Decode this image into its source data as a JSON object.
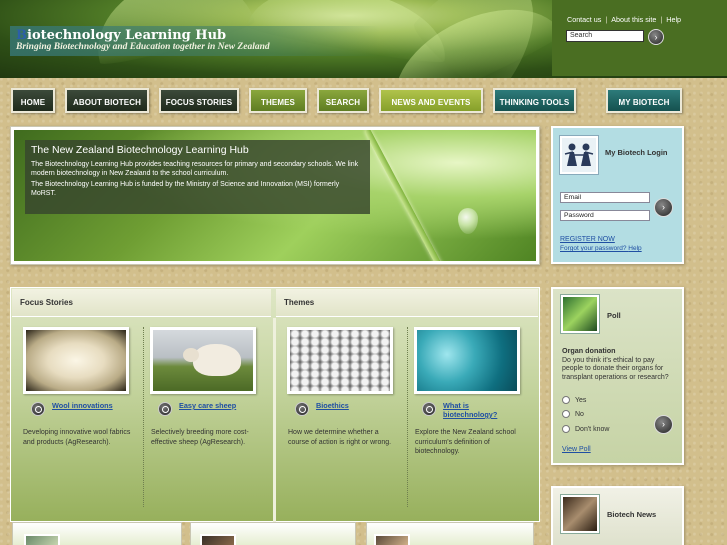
{
  "header": {
    "title_first": "B",
    "title_rest": "iotechnology Learning Hub",
    "tagline": "Bringing Biotechnology and Education together in New Zealand",
    "links": [
      "Contact us",
      "About this site",
      "Help"
    ],
    "search_placeholder": "Search",
    "go_symbol": "›"
  },
  "nav": [
    "HOME",
    "ABOUT BIOTECH",
    "FOCUS STORIES",
    "THEMES",
    "SEARCH",
    "NEWS AND EVENTS",
    "THINKING TOOLS",
    "MY BIOTECH"
  ],
  "hero": {
    "title": "The New Zealand Biotechnology Learning Hub",
    "p1": "The Biotechnology Learning Hub provides teaching resources for primary and secondary schools. We link modern biotechnology in New Zealand to the school curriculum.",
    "p2": "The Biotechnology Learning Hub is funded by the Ministry of Science and Innovation (MSI) formerly MoRST."
  },
  "login": {
    "title": "My Biotech Login",
    "email_placeholder": "Email",
    "password_placeholder": "Password",
    "register": "REGISTER NOW",
    "forgot": "Forgot your password?",
    "help": "Help"
  },
  "focus": {
    "heading": "Focus Stories",
    "cards": [
      {
        "title": "Wool innovations",
        "desc": "Developing innovative wool fabrics and products (AgResearch)."
      },
      {
        "title": "Easy care sheep",
        "desc": "Selectively breeding more cost-effective sheep (AgResearch)."
      }
    ]
  },
  "themes": {
    "heading": "Themes",
    "cards": [
      {
        "title": "Bioethics",
        "desc": "How we determine whether a course of action is right or wrong."
      },
      {
        "title": "What is biotechnology?",
        "desc": "Explore the New Zealand school curriculum's definition of biotechnology."
      }
    ]
  },
  "poll": {
    "title": "Poll",
    "question_title": "Organ donation",
    "question": "Do you think it's ethical to pay people to donate their organs for transplant operations or research?",
    "options": [
      "Yes",
      "No",
      "Don't know"
    ],
    "view": "View Poll"
  },
  "news": {
    "title": "Biotech News"
  }
}
